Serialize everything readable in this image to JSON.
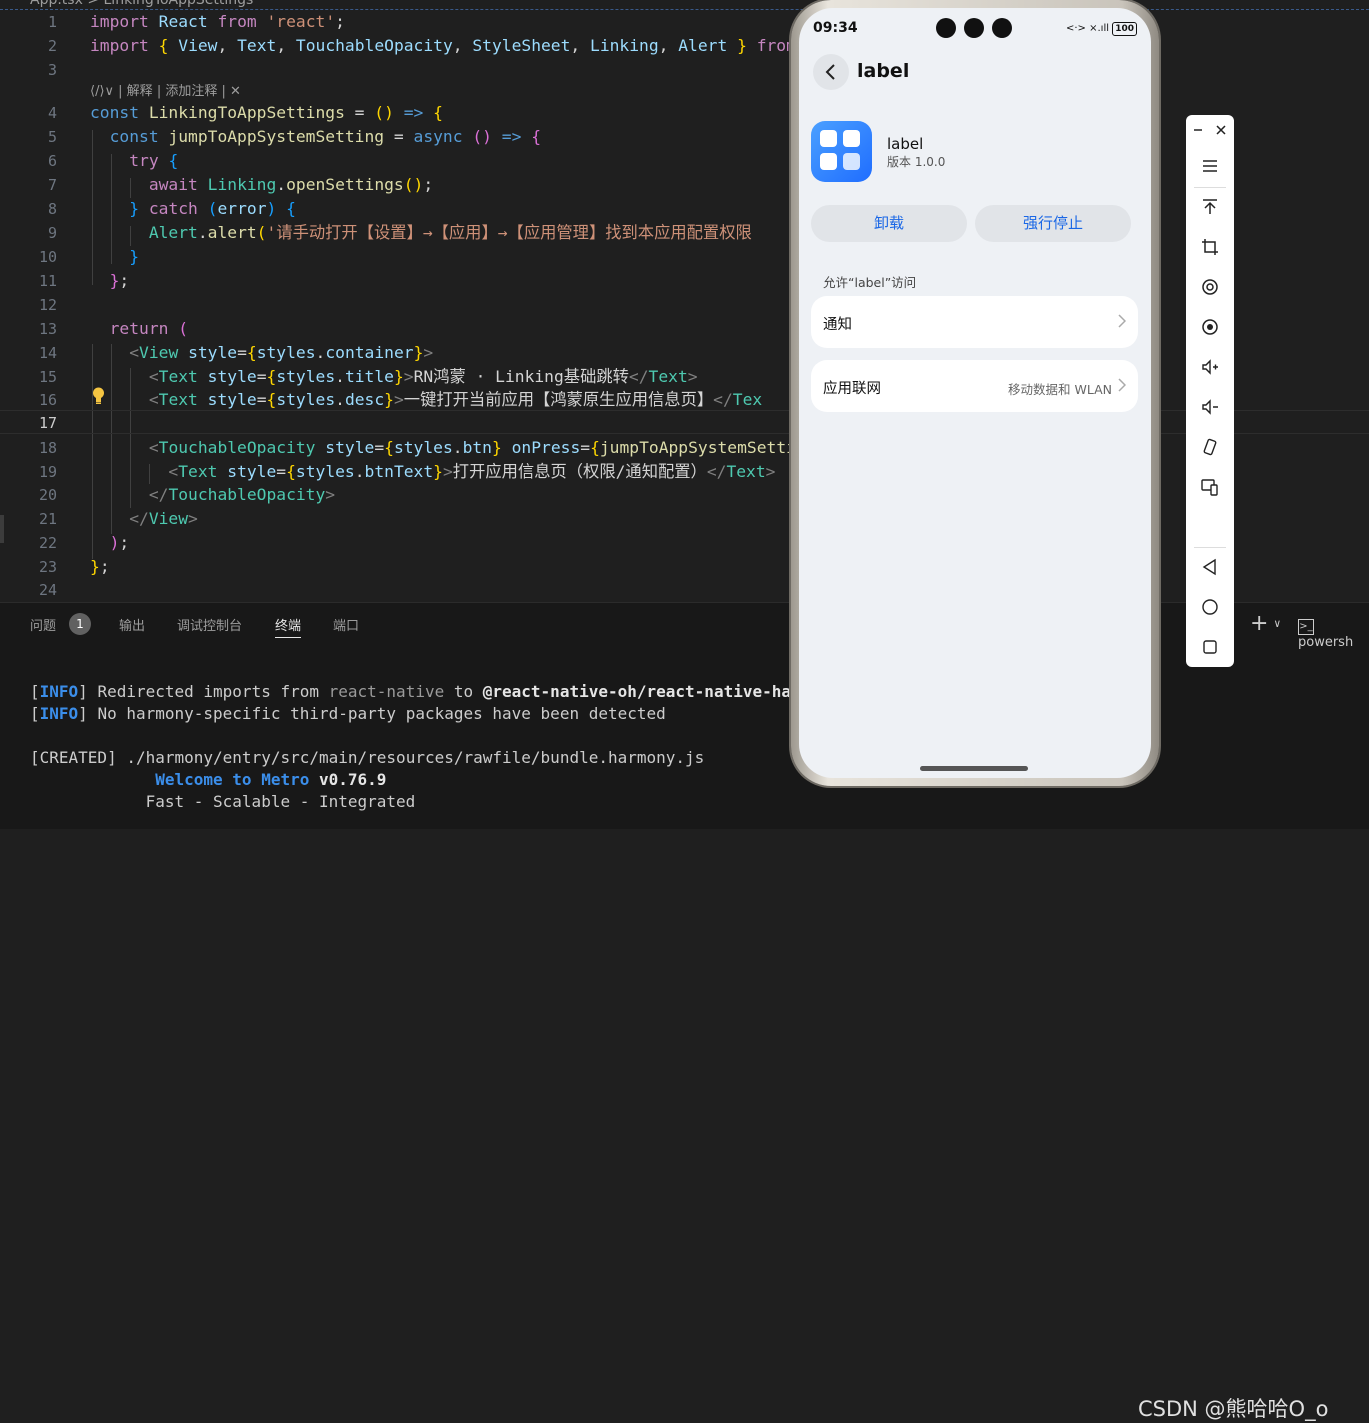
{
  "editor": {
    "breadcrumb": "App.tsx > LinkingToAppSettings",
    "codelens": "⟨/⟩∨ | 解释 | 添加注释 | ✕",
    "line_numbers": [
      "1",
      "2",
      "3",
      "4",
      "5",
      "6",
      "7",
      "8",
      "9",
      "10",
      "11",
      "12",
      "13",
      "14",
      "15",
      "16",
      "17",
      "18",
      "19",
      "20",
      "21",
      "22",
      "23",
      "24"
    ],
    "current_line": "17"
  },
  "panel": {
    "tabs": [
      "问题",
      "输出",
      "调试控制台",
      "终端",
      "端口"
    ],
    "active_tab": "终端",
    "problems_count": "1",
    "shell": "powersh",
    "terminal": {
      "info_tag": "INFO",
      "created_tag": "[CREATED]",
      "line1_a": "Redirected imports from ",
      "line1_b": "react-native",
      "line1_c": " to ",
      "line1_d": "@react-native-oh/react-native-harmony",
      "line2": "No harmony-specific third-party packages have been detected",
      "line3": " ./harmony/entry/src/main/resources/rawfile/bundle.harmony.js",
      "welcome": "Welcome to Metro",
      "version": "v0.76.9",
      "tagline": "Fast - Scalable - Integrated"
    }
  },
  "phone": {
    "time": "09:34",
    "status_right": "<·> ×.ıll",
    "battery": "100",
    "nav_title": "label",
    "app_name": "label",
    "app_version": "版本 1.0.0",
    "uninstall": "卸载",
    "force_stop": "强行停止",
    "section": "允许“label”访问",
    "rows": [
      {
        "label": "通知",
        "value": ""
      },
      {
        "label": "应用联网",
        "value": "移动数据和 WLAN"
      }
    ]
  },
  "toolbar_icons": [
    "minimize-icon",
    "close-icon",
    "menu-icon",
    "pin-top-icon",
    "crop-icon",
    "screenshot-icon",
    "screen-record-icon",
    "volume-up-icon",
    "volume-down-icon",
    "rotate-icon",
    "multi-device-icon",
    "back-icon",
    "home-icon",
    "recents-icon"
  ],
  "watermark": "CSDN @熊哈哈O_o",
  "colors": {
    "accent_blue": "#1a67e6",
    "editor_bg": "#1f1f1f",
    "terminal_info": "#3b8eea"
  }
}
